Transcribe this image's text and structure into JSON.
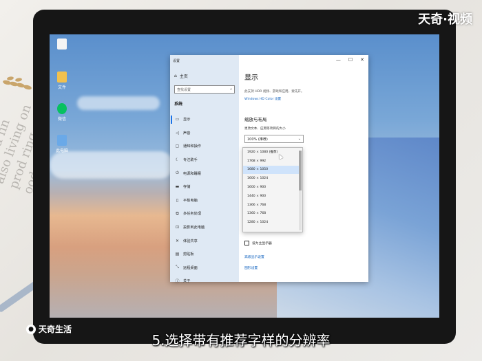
{
  "background": {
    "paper_text": [
      "a dead fin",
      "also living on",
      "prod ring",
      "ood yogi"
    ]
  },
  "watermark": {
    "top_right": "天奇·视频",
    "bottom_left": "天奇生活"
  },
  "caption": "5.选择带有推荐字样的分辨率",
  "desktop_icons": [
    {
      "label": "",
      "color": "#f4f4f4"
    },
    {
      "label": "文件",
      "color": "#f2c14e"
    },
    {
      "label": "微信",
      "color": "#07c160"
    },
    {
      "label": "此电脑",
      "color": "#6aa9e8"
    }
  ],
  "settings_window": {
    "title": "设置",
    "home": "主页",
    "search_placeholder": "查找设置",
    "section": "系统",
    "nav_items": [
      {
        "label": "显示",
        "icon": "monitor-icon"
      },
      {
        "label": "声音",
        "icon": "speaker-icon"
      },
      {
        "label": "通知和操作",
        "icon": "notification-icon"
      },
      {
        "label": "专注助手",
        "icon": "moon-icon"
      },
      {
        "label": "电源和睡眠",
        "icon": "power-icon"
      },
      {
        "label": "存储",
        "icon": "storage-icon"
      },
      {
        "label": "平板电脑",
        "icon": "tablet-icon"
      },
      {
        "label": "多任务处理",
        "icon": "multitask-icon"
      },
      {
        "label": "投影到此电脑",
        "icon": "project-icon"
      },
      {
        "label": "体验共享",
        "icon": "share-icon"
      },
      {
        "label": "剪贴板",
        "icon": "clipboard-icon"
      },
      {
        "label": "远程桌面",
        "icon": "remote-icon"
      },
      {
        "label": "关于",
        "icon": "info-icon"
      }
    ],
    "controls": {
      "minimize": "—",
      "maximize": "☐",
      "close": "✕"
    },
    "heading": "显示",
    "hdr_note": "此支持 HDR 视频、游戏和应用，要先开。",
    "hdr_link": "Windows HD Color 设置",
    "scale_heading": "缩放与布局",
    "scale_label": "更改文本、应用等项目的大小",
    "scale_value": "100% (推荐)",
    "resolutions": [
      "1920 × 1080 (推荐)",
      "1768 × 992",
      "1680 × 1050",
      "1600 × 1024",
      "1600 × 900",
      "1440 × 900",
      "1366 × 768",
      "1360 × 768",
      "1280 × 1024"
    ],
    "highlighted_resolution": "1680 × 1050",
    "main_display_label": "设为主显示器",
    "advanced_link": "高级显示设置",
    "graphics_link": "图形设置"
  }
}
